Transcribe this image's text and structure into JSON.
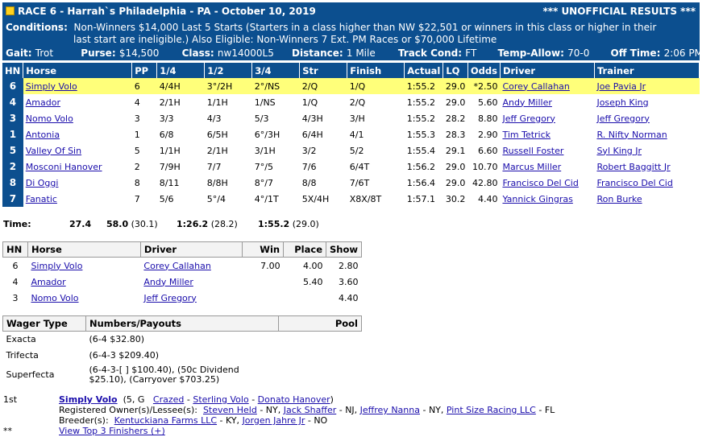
{
  "header": {
    "race": "RACE 6",
    "track": "Harrah`s Philadelphia",
    "state": "PA",
    "date": "October 10, 2019",
    "status": "*** UNOFFICIAL RESULTS ***",
    "conditions_label": "Conditions:",
    "conditions_line1": "Non-Winners $14,000 Last 5 Starts (Starters in a class higher than NW $22,501 or winners in this class or higher in their",
    "conditions_line2": "last start are ineligible.) Also Eligible: Non-Winners 7 Ext. PM Races or $70,000 Lifetime",
    "gait_label": "Gait:",
    "gait": "Trot",
    "purse_label": "Purse:",
    "purse": "$14,500",
    "class_label": "Class:",
    "class": "nw14000L5",
    "distance_label": "Distance:",
    "distance": "1 Mile",
    "track_cond_label": "Track Cond:",
    "track_cond": "FT",
    "temp_label": "Temp-Allow:",
    "temp": "70-0",
    "off_label": "Off Time:",
    "off_time": "2:06 PM"
  },
  "results": {
    "columns": [
      "HN",
      "Horse",
      "PP",
      "1/4",
      "1/2",
      "3/4",
      "Str",
      "Finish",
      "Actual",
      "LQ",
      "Odds",
      "Driver",
      "Trainer"
    ],
    "rows": [
      {
        "hn": "6",
        "horse": "Simply Volo",
        "pp": "6",
        "q1": "4/4H",
        "q2": "3°/2H",
        "q3": "2°/NS",
        "str": "2/Q",
        "fin": "1/Q",
        "actual": "1:55.2",
        "lq": "29.0",
        "odds": "*2.50",
        "driver": "Corey Callahan",
        "trainer": "Joe Pavia Jr"
      },
      {
        "hn": "4",
        "horse": "Amador",
        "pp": "4",
        "q1": "2/1H",
        "q2": "1/1H",
        "q3": "1/NS",
        "str": "1/Q",
        "fin": "2/Q",
        "actual": "1:55.2",
        "lq": "29.0",
        "odds": "5.60",
        "driver": "Andy Miller",
        "trainer": "Joseph King"
      },
      {
        "hn": "3",
        "horse": "Nomo Volo",
        "pp": "3",
        "q1": "3/3",
        "q2": "4/3",
        "q3": "5/3",
        "str": "4/3H",
        "fin": "3/H",
        "actual": "1:55.2",
        "lq": "28.2",
        "odds": "8.80",
        "driver": "Jeff Gregory",
        "trainer": "Jeff Gregory"
      },
      {
        "hn": "1",
        "horse": "Antonia",
        "pp": "1",
        "q1": "6/8",
        "q2": "6/5H",
        "q3": "6°/3H",
        "str": "6/4H",
        "fin": "4/1",
        "actual": "1:55.3",
        "lq": "28.3",
        "odds": "2.90",
        "driver": "Tim Tetrick",
        "trainer": "R. Nifty Norman"
      },
      {
        "hn": "5",
        "horse": "Valley Of Sin",
        "pp": "5",
        "q1": "1/1H",
        "q2": "2/1H",
        "q3": "3/1H",
        "str": "3/2",
        "fin": "5/2",
        "actual": "1:55.4",
        "lq": "29.1",
        "odds": "6.60",
        "driver": "Russell Foster",
        "trainer": "Syl King Jr"
      },
      {
        "hn": "2",
        "horse": "Mosconi Hanover",
        "pp": "2",
        "q1": "7/9H",
        "q2": "7/7",
        "q3": "7°/5",
        "str": "7/6",
        "fin": "6/4T",
        "actual": "1:56.2",
        "lq": "29.0",
        "odds": "10.70",
        "driver": "Marcus Miller",
        "trainer": "Robert Baggitt Jr"
      },
      {
        "hn": "8",
        "horse": "Di Oggi",
        "pp": "8",
        "q1": "8/11",
        "q2": "8/8H",
        "q3": "8°/7",
        "str": "8/8",
        "fin": "7/6T",
        "actual": "1:56.4",
        "lq": "29.0",
        "odds": "42.80",
        "driver": "Francisco Del Cid",
        "trainer": "Francisco Del Cid"
      },
      {
        "hn": "7",
        "horse": "Fanatic",
        "pp": "7",
        "q1": "5/6",
        "q2": "5°/4",
        "q3": "4°/1T",
        "str": "5X/4H",
        "fin": "X8X/8T",
        "actual": "1:57.1",
        "lq": "30.2",
        "odds": "4.40",
        "driver": "Yannick Gingras",
        "trainer": "Ron Burke"
      }
    ]
  },
  "times": {
    "label": "Time:",
    "q1": "27.4",
    "q2": "58.0",
    "q2s": "(30.1)",
    "q3": "1:26.2",
    "q3s": "(28.2)",
    "fin": "1:55.2",
    "fins": "(29.0)"
  },
  "wps": {
    "columns": [
      "HN",
      "Horse",
      "Driver",
      "Win",
      "Place",
      "Show"
    ],
    "rows": [
      {
        "hn": "6",
        "horse": "Simply Volo",
        "driver": "Corey Callahan",
        "win": "7.00",
        "place": "4.00",
        "show": "2.80"
      },
      {
        "hn": "4",
        "horse": "Amador",
        "driver": "Andy Miller",
        "win": "",
        "place": "5.40",
        "show": "3.60"
      },
      {
        "hn": "3",
        "horse": "Nomo Volo",
        "driver": "Jeff Gregory",
        "win": "",
        "place": "",
        "show": "4.40"
      }
    ]
  },
  "wagers": {
    "columns": [
      "Wager Type",
      "Numbers/Payouts",
      "Pool"
    ],
    "rows": [
      {
        "type": "Exacta",
        "payout1": "(6-4 $32.80)",
        "payout2": ""
      },
      {
        "type": "Trifecta",
        "payout1": "(6-4-3 $209.40)",
        "payout2": ""
      },
      {
        "type": "Superfecta",
        "payout1": "(6-4-3-[ ] $100.40), (50c Dividend",
        "payout2": "$25.10), (Carryover $703.25)"
      }
    ]
  },
  "winner": {
    "place": "1st",
    "horse": "Simply Volo",
    "age_sex": "(5, G",
    "sire": "Crazed",
    "dam": "Sterling Volo",
    "damsire": "Donato Hanover",
    "owners_label": "Registered Owner(s)/Lessee(s):",
    "owner1": "Steven Held",
    "owner1_loc": "- NY,",
    "owner2": "Jack Shaffer",
    "owner2_loc": "- NJ,",
    "owner3": "Jeffrey Nanna",
    "owner3_loc": "- NY,",
    "owner4": "Pint Size Racing LLC",
    "owner4_loc": "- FL",
    "breeders_label": "Breeder(s):",
    "breeder1": "Kentuckiana Farms LLC",
    "breeder1_loc": "- KY,",
    "breeder2": "Jorgen Jahre Jr",
    "breeder2_loc": "- NO",
    "more_prefix": "**",
    "more_link": "View Top 3 Finishers (+)"
  }
}
